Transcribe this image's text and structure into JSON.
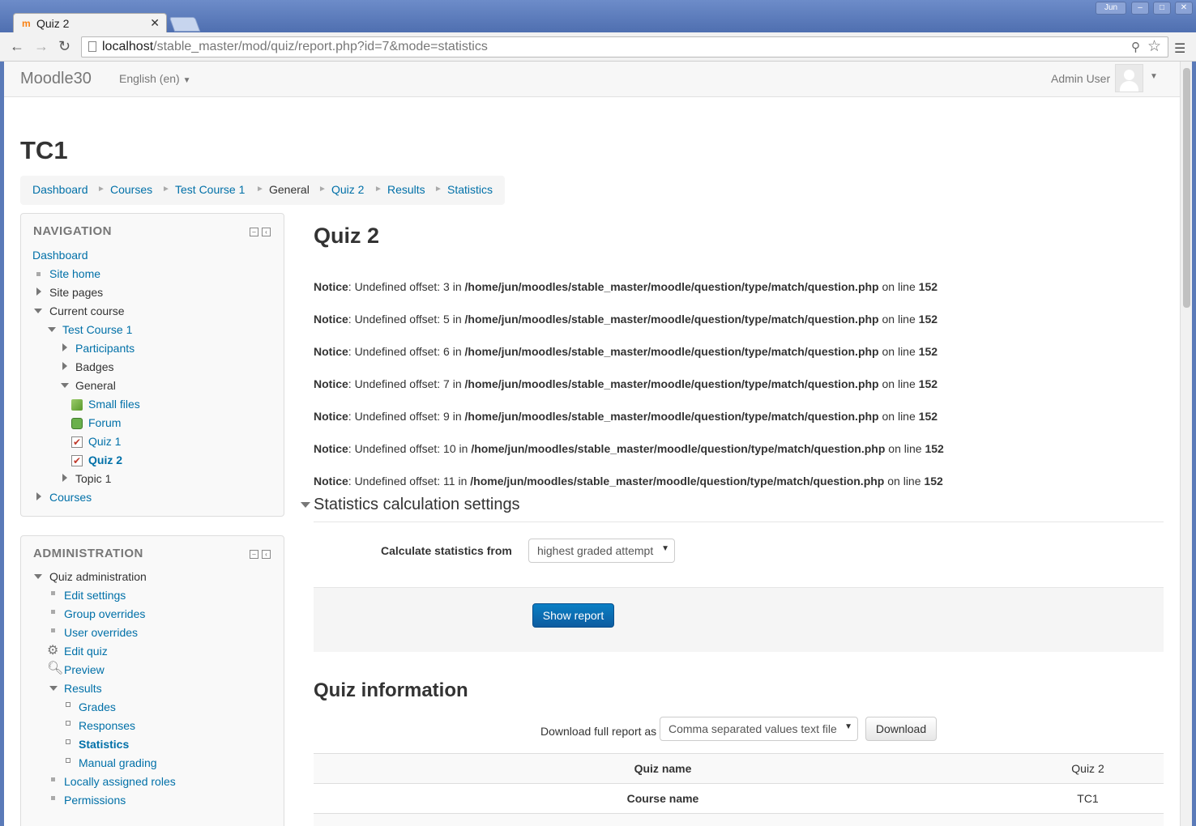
{
  "browser": {
    "tab_title": "Quiz 2",
    "tab_favicon": "moodle-favicon",
    "url_host": "localhost",
    "url_path": "/stable_master/mod/quiz/report.php?id=7&mode=statistics",
    "window_user_label": "Jun"
  },
  "navbar": {
    "brand": "Moodle30",
    "language": "English (en)",
    "user_name": "Admin User"
  },
  "page_heading": "TC1",
  "breadcrumb": [
    "Dashboard",
    "Courses",
    "Test Course 1",
    "General",
    "Quiz 2",
    "Results",
    "Statistics"
  ],
  "navigation": {
    "title": "NAVIGATION",
    "items": {
      "dashboard": "Dashboard",
      "site_home": "Site home",
      "site_pages": "Site pages",
      "current_course": "Current course",
      "test_course": "Test Course 1",
      "participants": "Participants",
      "badges": "Badges",
      "general": "General",
      "small_files": "Small files",
      "forum": "Forum",
      "quiz1": "Quiz 1",
      "quiz2": "Quiz 2",
      "topic1": "Topic 1",
      "courses": "Courses"
    }
  },
  "administration": {
    "title": "ADMINISTRATION",
    "items": {
      "quiz_admin": "Quiz administration",
      "edit_settings": "Edit settings",
      "group_overrides": "Group overrides",
      "user_overrides": "User overrides",
      "edit_quiz": "Edit quiz",
      "preview": "Preview",
      "results": "Results",
      "grades": "Grades",
      "responses": "Responses",
      "statistics": "Statistics",
      "manual_grading": "Manual grading",
      "local_roles": "Locally assigned roles",
      "permissions": "Permissions"
    }
  },
  "main": {
    "title": "Quiz 2",
    "notices": [
      {
        "label": "Notice",
        "msg": ": Undefined offset: 3 in ",
        "file": "/home/jun/moodles/stable_master/moodle/question/type/match/question.php",
        "online": " on line ",
        "line": "152"
      },
      {
        "label": "Notice",
        "msg": ": Undefined offset: 5 in ",
        "file": "/home/jun/moodles/stable_master/moodle/question/type/match/question.php",
        "online": " on line ",
        "line": "152"
      },
      {
        "label": "Notice",
        "msg": ": Undefined offset: 6 in ",
        "file": "/home/jun/moodles/stable_master/moodle/question/type/match/question.php",
        "online": " on line ",
        "line": "152"
      },
      {
        "label": "Notice",
        "msg": ": Undefined offset: 7 in ",
        "file": "/home/jun/moodles/stable_master/moodle/question/type/match/question.php",
        "online": " on line ",
        "line": "152"
      },
      {
        "label": "Notice",
        "msg": ": Undefined offset: 9 in ",
        "file": "/home/jun/moodles/stable_master/moodle/question/type/match/question.php",
        "online": " on line ",
        "line": "152"
      },
      {
        "label": "Notice",
        "msg": ": Undefined offset: 10 in ",
        "file": "/home/jun/moodles/stable_master/moodle/question/type/match/question.php",
        "online": " on line ",
        "line": "152"
      },
      {
        "label": "Notice",
        "msg": ": Undefined offset: 11 in ",
        "file": "/home/jun/moodles/stable_master/moodle/question/type/match/question.php",
        "online": " on line ",
        "line": "152"
      }
    ],
    "settings_legend": "Statistics calculation settings",
    "calc_label": "Calculate statistics from",
    "calc_value": "highest graded attempt",
    "show_report": "Show report",
    "quiz_info_title": "Quiz information",
    "download_label": "Download full report as",
    "download_format": "Comma separated values text file",
    "download_button": "Download",
    "info_rows": [
      {
        "key": "Quiz name",
        "value": "Quiz 2"
      },
      {
        "key": "Course name",
        "value": "TC1"
      }
    ]
  }
}
